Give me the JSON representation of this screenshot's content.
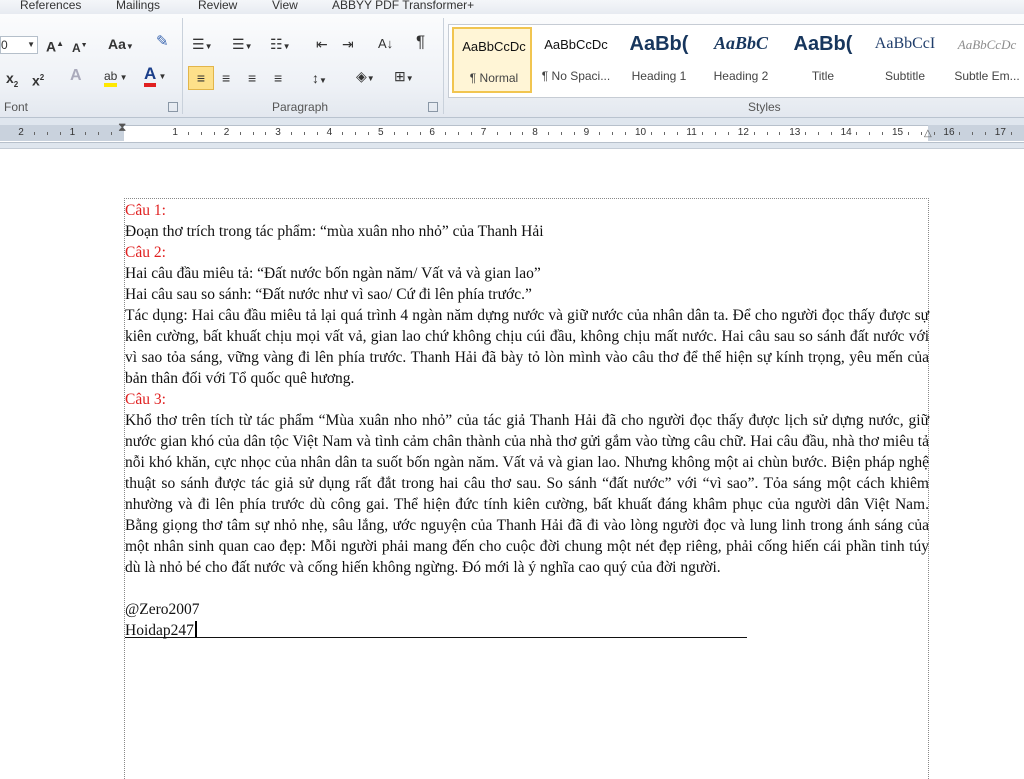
{
  "tabs": [
    "References",
    "Mailings",
    "Review",
    "View",
    "ABBYY PDF Transformer+"
  ],
  "font_group": {
    "label": "Font",
    "size_value": "0",
    "grow_font": "A",
    "shrink_font": "A",
    "change_case": "Aa",
    "subscript": "x",
    "superscript": "x",
    "text_effects": "A",
    "highlight": "ab",
    "font_color": "A"
  },
  "paragraph_group": {
    "label": "Paragraph"
  },
  "styles_group": {
    "label": "Styles",
    "items": [
      {
        "preview": "AaBbCcDc",
        "name": "¶ Normal"
      },
      {
        "preview": "AaBbCcDc",
        "name": "¶ No Spaci..."
      },
      {
        "preview": "AaBb(",
        "name": "Heading 1"
      },
      {
        "preview": "AaBbC",
        "name": "Heading 2"
      },
      {
        "preview": "AaBb(",
        "name": "Title"
      },
      {
        "preview": "AaBbCcI",
        "name": "Subtitle"
      },
      {
        "preview": "AaBbCcDc",
        "name": "Subtle Em..."
      }
    ]
  },
  "ruler_numbers": [
    "2",
    "1",
    "1",
    "2",
    "3",
    "4",
    "5",
    "6",
    "7",
    "8",
    "9",
    "10",
    "11",
    "12",
    "13",
    "14",
    "15",
    "16",
    "17"
  ],
  "document": {
    "q1_label": "Câu 1:",
    "q1_text": "Đoạn thơ trích trong tác phẩm: “mùa xuân nho nhỏ” của Thanh Hải",
    "q2_label": "Câu 2:",
    "q2_line1": "Hai câu đầu miêu tả: “Đất nước bốn ngàn năm/ Vất vả và gian lao”",
    "q2_line2": "Hai câu sau so sánh: “Đất nước như vì sao/ Cứ đi lên phía trước.”",
    "q2_para": "Tác dụng: Hai câu đầu miêu tả lại quá trình 4 ngàn năm dựng nước và giữ nước của nhân dân ta. Để cho người đọc thấy được sự kiên cường, bất khuất chịu mọi vất vả, gian lao chứ không chịu cúi đầu, không chịu mất nước. Hai câu sau so sánh đất nước với vì sao tỏa sáng, vững vàng đi lên phía trước. Thanh Hải đã bày tỏ lòn mình vào câu thơ để thể hiện sự kính trọng, yêu mến của bản thân đối với Tổ quốc quê hương.",
    "q3_label": "Câu 3:",
    "q3_para": "Khổ thơ trên tích từ tác phẩm “Mùa xuân nho nhỏ” của tác giả Thanh Hải đã cho người đọc thấy được lịch sử dựng nước, giữ nước gian khó của dân tộc Việt Nam và tình cảm chân thành của nhà thơ gửi gắm vào từng câu chữ. Hai câu đầu, nhà thơ miêu tả nỗi khó khăn, cực nhọc của nhân dân ta suốt bốn ngàn năm. Vất vả và gian lao. Nhưng không một ai chùn bước. Biện pháp nghệ thuật so sánh được tác giả sử dụng rất đắt trong hai câu thơ sau. So sánh “đất nước” với “vì sao”. Tỏa sáng một cách khiêm nhường và đi lên phía trước dù công gai. Thể hiện đức tính kiên cường, bất khuất đáng khâm phục của người dân Việt Nam. Bằng giọng thơ tâm sự nhỏ nhẹ, sâu lắng, ước nguyện của Thanh Hải đã đi vào lòng người đọc và lung linh trong ánh sáng của một nhân sinh quan cao đẹp: Mỗi người phải mang đến cho cuộc đời chung một nét đẹp riêng, phải cống hiến cái phần tinh túy dù là nhỏ bé cho đất nước và cống hiến không ngừng. Đó mới là ý nghĩa cao quý của đời người.",
    "signature1": "@Zero2007",
    "signature2": "Hoidap247"
  },
  "colors": {
    "accent_red": "#e02020",
    "selected_style": "#f1c550"
  }
}
